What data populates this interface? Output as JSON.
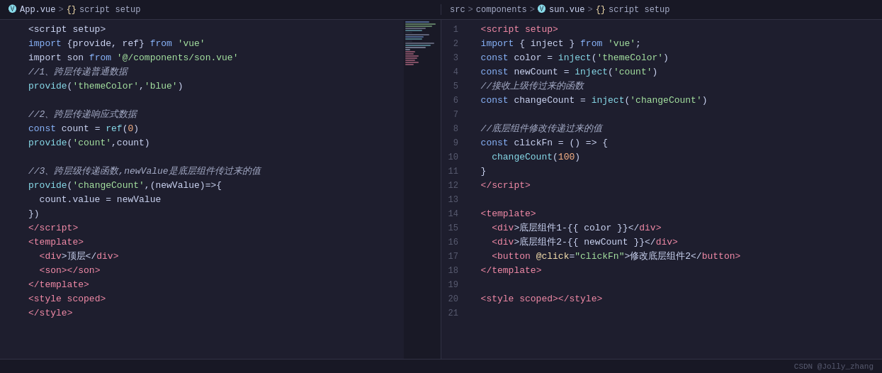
{
  "left_pane": {
    "breadcrumb": "App.vue > {} script setup",
    "lines": [
      {
        "num": "",
        "tokens": [
          {
            "text": "<script setup>",
            "cls": ""
          }
        ]
      },
      {
        "num": "",
        "tokens": [
          {
            "text": "import ",
            "cls": "kw"
          },
          {
            "text": "{provide, ref} ",
            "cls": "white"
          },
          {
            "text": "from ",
            "cls": "kw"
          },
          {
            "text": "'vue'",
            "cls": "str"
          }
        ]
      },
      {
        "num": "",
        "tokens": [
          {
            "text": "import son ",
            "cls": "white"
          },
          {
            "text": "from ",
            "cls": "kw"
          },
          {
            "text": "'@/components/son.vue'",
            "cls": "str"
          }
        ]
      },
      {
        "num": "",
        "tokens": [
          {
            "text": "//1、跨层传递普通数据",
            "cls": "comment-zh"
          }
        ]
      },
      {
        "num": "",
        "tokens": [
          {
            "text": "provide",
            "cls": "cyan"
          },
          {
            "text": "(",
            "cls": "white"
          },
          {
            "text": "'themeColor'",
            "cls": "str"
          },
          {
            "text": ",",
            "cls": "white"
          },
          {
            "text": "'blue'",
            "cls": "str"
          },
          {
            "text": ")",
            "cls": "white"
          }
        ]
      },
      {
        "num": "",
        "tokens": [
          {
            "text": "",
            "cls": ""
          }
        ]
      },
      {
        "num": "",
        "tokens": [
          {
            "text": "//2、跨层传递响应式数据",
            "cls": "comment-zh"
          }
        ]
      },
      {
        "num": "",
        "tokens": [
          {
            "text": "const ",
            "cls": "blue"
          },
          {
            "text": "count ",
            "cls": "white"
          },
          {
            "text": "= ",
            "cls": "white"
          },
          {
            "text": "ref",
            "cls": "cyan"
          },
          {
            "text": "(",
            "cls": "white"
          },
          {
            "text": "0",
            "cls": "num"
          },
          {
            "text": ")",
            "cls": "white"
          }
        ]
      },
      {
        "num": "",
        "tokens": [
          {
            "text": "provide",
            "cls": "cyan"
          },
          {
            "text": "(",
            "cls": "white"
          },
          {
            "text": "'count'",
            "cls": "str"
          },
          {
            "text": ",count)",
            "cls": "white"
          }
        ]
      },
      {
        "num": "",
        "tokens": [
          {
            "text": "",
            "cls": ""
          }
        ]
      },
      {
        "num": "",
        "tokens": [
          {
            "text": "//3、跨层级传递函数,newValue是底层组件传过来的值",
            "cls": "comment-zh"
          }
        ]
      },
      {
        "num": "",
        "tokens": [
          {
            "text": "provide",
            "cls": "cyan"
          },
          {
            "text": "(",
            "cls": "white"
          },
          {
            "text": "'changeCount'",
            "cls": "str"
          },
          {
            "text": ",(newValue)=>{",
            "cls": "white"
          }
        ]
      },
      {
        "num": "",
        "tokens": [
          {
            "text": "  count.value ",
            "cls": "white"
          },
          {
            "text": "= ",
            "cls": "white"
          },
          {
            "text": "newValue",
            "cls": "white"
          }
        ]
      },
      {
        "num": "",
        "tokens": [
          {
            "text": "})",
            "cls": "white"
          }
        ]
      },
      {
        "num": "",
        "tokens": [
          {
            "text": "</",
            "cls": "red"
          },
          {
            "text": "script",
            "cls": "red"
          },
          {
            "text": ">",
            "cls": "red"
          }
        ]
      },
      {
        "num": "",
        "tokens": [
          {
            "text": "<",
            "cls": "red"
          },
          {
            "text": "template",
            "cls": "red"
          },
          {
            "text": ">",
            "cls": "red"
          }
        ]
      },
      {
        "num": "",
        "tokens": [
          {
            "text": "  <",
            "cls": "red"
          },
          {
            "text": "div",
            "cls": "red"
          },
          {
            "text": ">顶层</",
            "cls": "white"
          },
          {
            "text": "div",
            "cls": "red"
          },
          {
            "text": ">",
            "cls": "red"
          }
        ]
      },
      {
        "num": "",
        "tokens": [
          {
            "text": "  <",
            "cls": "red"
          },
          {
            "text": "son",
            "cls": "red"
          },
          {
            "text": "></",
            "cls": "red"
          },
          {
            "text": "son",
            "cls": "red"
          },
          {
            "text": ">",
            "cls": "red"
          }
        ]
      },
      {
        "num": "",
        "tokens": [
          {
            "text": "</",
            "cls": "red"
          },
          {
            "text": "template",
            "cls": "red"
          },
          {
            "text": ">",
            "cls": "red"
          }
        ]
      },
      {
        "num": "",
        "tokens": [
          {
            "text": "<",
            "cls": "red"
          },
          {
            "text": "style scoped",
            "cls": "red"
          },
          {
            "text": ">",
            "cls": "red"
          }
        ]
      },
      {
        "num": "",
        "tokens": [
          {
            "text": "</",
            "cls": "red"
          },
          {
            "text": "style",
            "cls": "red"
          },
          {
            "text": ">",
            "cls": "red"
          }
        ]
      }
    ]
  },
  "right_pane": {
    "breadcrumb": "src > components > sun.vue > {} script setup",
    "lines": [
      {
        "num": "1",
        "tokens": [
          {
            "text": "  <",
            "cls": "red"
          },
          {
            "text": "script setup",
            "cls": "red"
          },
          {
            "text": ">",
            "cls": "red"
          }
        ]
      },
      {
        "num": "2",
        "tokens": [
          {
            "text": "  import ",
            "cls": "blue"
          },
          {
            "text": "{ inject } ",
            "cls": "white"
          },
          {
            "text": "from ",
            "cls": "blue"
          },
          {
            "text": "'vue'",
            "cls": "str"
          },
          {
            "text": ";",
            "cls": "white"
          }
        ]
      },
      {
        "num": "3",
        "tokens": [
          {
            "text": "  const ",
            "cls": "blue"
          },
          {
            "text": "color ",
            "cls": "white"
          },
          {
            "text": "= ",
            "cls": "white"
          },
          {
            "text": "inject",
            "cls": "cyan"
          },
          {
            "text": "(",
            "cls": "white"
          },
          {
            "text": "'themeColor'",
            "cls": "str"
          },
          {
            "text": ")",
            "cls": "white"
          }
        ]
      },
      {
        "num": "4",
        "tokens": [
          {
            "text": "  const ",
            "cls": "blue"
          },
          {
            "text": "newCount ",
            "cls": "white"
          },
          {
            "text": "= ",
            "cls": "white"
          },
          {
            "text": "inject",
            "cls": "cyan"
          },
          {
            "text": "(",
            "cls": "white"
          },
          {
            "text": "'count'",
            "cls": "str"
          },
          {
            "text": ")",
            "cls": "white"
          }
        ]
      },
      {
        "num": "5",
        "tokens": [
          {
            "text": "  //接收上级传过来的函数",
            "cls": "comment-zh"
          }
        ]
      },
      {
        "num": "6",
        "tokens": [
          {
            "text": "  const ",
            "cls": "blue"
          },
          {
            "text": "changeCount ",
            "cls": "white"
          },
          {
            "text": "= ",
            "cls": "white"
          },
          {
            "text": "inject",
            "cls": "cyan"
          },
          {
            "text": "(",
            "cls": "white"
          },
          {
            "text": "'changeCount'",
            "cls": "str"
          },
          {
            "text": ")",
            "cls": "white"
          }
        ]
      },
      {
        "num": "7",
        "tokens": [
          {
            "text": "",
            "cls": ""
          }
        ]
      },
      {
        "num": "8",
        "tokens": [
          {
            "text": "  //底层组件修改传递过来的值",
            "cls": "comment-zh"
          }
        ]
      },
      {
        "num": "9",
        "tokens": [
          {
            "text": "  const ",
            "cls": "blue"
          },
          {
            "text": "clickFn ",
            "cls": "white"
          },
          {
            "text": "= () => {",
            "cls": "white"
          }
        ]
      },
      {
        "num": "10",
        "tokens": [
          {
            "text": "    changeCount",
            "cls": "cyan"
          },
          {
            "text": "(",
            "cls": "white"
          },
          {
            "text": "100",
            "cls": "num"
          },
          {
            "text": ")",
            "cls": "white"
          }
        ]
      },
      {
        "num": "11",
        "tokens": [
          {
            "text": "  }",
            "cls": "white"
          }
        ]
      },
      {
        "num": "12",
        "tokens": [
          {
            "text": "  </",
            "cls": "red"
          },
          {
            "text": "script",
            "cls": "red"
          },
          {
            "text": ">",
            "cls": "red"
          }
        ]
      },
      {
        "num": "13",
        "tokens": [
          {
            "text": "",
            "cls": ""
          }
        ]
      },
      {
        "num": "14",
        "tokens": [
          {
            "text": "  <",
            "cls": "red"
          },
          {
            "text": "template",
            "cls": "red"
          },
          {
            "text": ">",
            "cls": "red"
          }
        ]
      },
      {
        "num": "15",
        "tokens": [
          {
            "text": "    <",
            "cls": "red"
          },
          {
            "text": "div",
            "cls": "red"
          },
          {
            "text": ">底层组件1-{{ color }}</",
            "cls": "white"
          },
          {
            "text": "div",
            "cls": "red"
          },
          {
            "text": ">",
            "cls": "red"
          }
        ]
      },
      {
        "num": "16",
        "tokens": [
          {
            "text": "    <",
            "cls": "red"
          },
          {
            "text": "div",
            "cls": "red"
          },
          {
            "text": ">底层组件2-{{ newCount }}</",
            "cls": "white"
          },
          {
            "text": "div",
            "cls": "red"
          },
          {
            "text": ">",
            "cls": "red"
          }
        ]
      },
      {
        "num": "17",
        "tokens": [
          {
            "text": "    <",
            "cls": "red"
          },
          {
            "text": "button ",
            "cls": "red"
          },
          {
            "text": "@click",
            "cls": "yellow"
          },
          {
            "text": "=",
            "cls": "white"
          },
          {
            "text": "\"clickFn\"",
            "cls": "str"
          },
          {
            "text": ">修改底层组件2</",
            "cls": "white"
          },
          {
            "text": "button",
            "cls": "red"
          },
          {
            "text": ">",
            "cls": "red"
          }
        ]
      },
      {
        "num": "18",
        "tokens": [
          {
            "text": "  </",
            "cls": "red"
          },
          {
            "text": "template",
            "cls": "red"
          },
          {
            "text": ">",
            "cls": "red"
          }
        ]
      },
      {
        "num": "19",
        "tokens": [
          {
            "text": "",
            "cls": ""
          }
        ]
      },
      {
        "num": "20",
        "tokens": [
          {
            "text": "  <",
            "cls": "red"
          },
          {
            "text": "style scoped",
            "cls": "red"
          },
          {
            "text": "></",
            "cls": "red"
          },
          {
            "text": "style",
            "cls": "red"
          },
          {
            "text": ">",
            "cls": "red"
          }
        ]
      },
      {
        "num": "21",
        "tokens": [
          {
            "text": "",
            "cls": ""
          }
        ]
      }
    ]
  },
  "status_bar": {
    "csdn": "CSDN @Jolly_zhang"
  }
}
